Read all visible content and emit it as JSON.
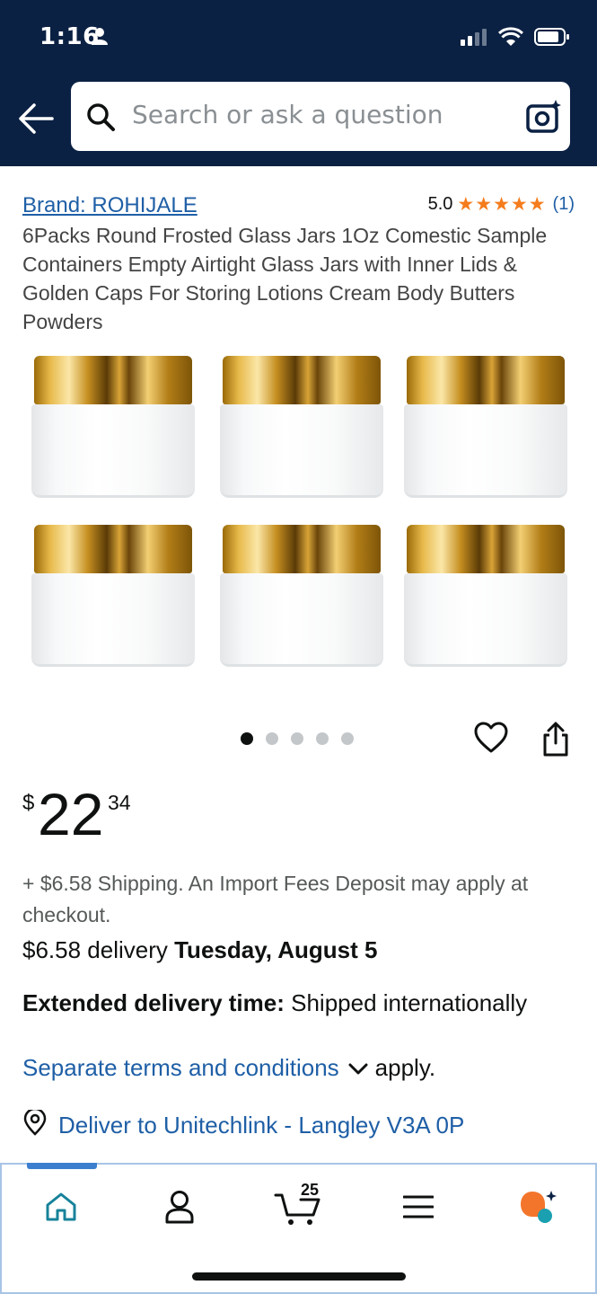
{
  "status_bar": {
    "time": "1:16"
  },
  "search": {
    "placeholder": "Search or ask a question"
  },
  "product": {
    "brand": "Brand: ROHIJALE",
    "rating": "5.0",
    "rating_count": "(1)",
    "stars_filled": 5,
    "title": "6Packs Round Frosted Glass Jars 1Oz Comestic Sample Containers Empty Airtight Glass Jars with Inner Lids & Golden Caps For Storing Lotions Cream Body Butters Powders",
    "image_count": 5,
    "active_image": 1
  },
  "price": {
    "symbol": "$",
    "whole": "22",
    "fraction": "34"
  },
  "shipping_note": "+ $6.58 Shipping. An Import Fees Deposit may apply at checkout.",
  "delivery": {
    "prefix": "$6.58 delivery ",
    "date": "Tuesday, August 5"
  },
  "extended": {
    "label": "Extended delivery time:",
    "text": " Shipped internationally"
  },
  "terms": {
    "link": "Separate terms and conditions",
    "suffix": "apply."
  },
  "deliver_to": "Deliver to Unitechlink - Langley V3A 0P",
  "nav": {
    "cart_count": "25"
  },
  "colors": {
    "header_bg": "#0b2143",
    "link": "#1f5fa6",
    "star": "#f57c1c"
  }
}
